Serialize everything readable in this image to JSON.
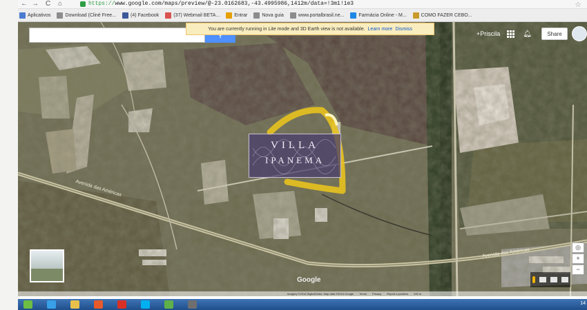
{
  "browser": {
    "nav": {
      "back": "←",
      "forward": "→",
      "reload": "C",
      "home": "⌂"
    },
    "url_scheme": "https://",
    "url_rest": "www.google.com/maps/preview/@-23.0162683,-43.4995986,1412m/data=!3m1!1e3"
  },
  "bookmarks": [
    {
      "label": "Aplicativos",
      "icon": "apps-icon",
      "color": "#4a7bd1"
    },
    {
      "label": "Download (Cliné Free...",
      "icon": "page-icon",
      "color": "#8c8c8c"
    },
    {
      "label": "(4) Facebook",
      "icon": "facebook-icon",
      "color": "#3b5998"
    },
    {
      "label": "(37) Webmail BETA...",
      "icon": "mail-icon",
      "color": "#d9534f"
    },
    {
      "label": "Entrar",
      "icon": "login-icon",
      "color": "#e6a000"
    },
    {
      "label": "Nova guia",
      "icon": "page-icon",
      "color": "#8c8c8c"
    },
    {
      "label": "www.portalbrasil.ne...",
      "icon": "page-icon",
      "color": "#8c8c8c"
    },
    {
      "label": "Farmácia Online - M...",
      "icon": "pharmacy-icon",
      "color": "#1e88e5"
    },
    {
      "label": "COMO FAZER CEBO...",
      "icon": "video-icon",
      "color": "#c89b2b"
    }
  ],
  "map": {
    "banner_text": "You are currently running in Lite mode and 3D Earth view is not available.",
    "banner_learn_more": "Learn more",
    "banner_dismiss": "Dismiss",
    "user_name": "+Priscila",
    "share_label": "Share",
    "road_label": "Avenida das Américas",
    "road_label_right": "Avenida das Américas",
    "logo": "Google",
    "watermark_line1": "VILLA",
    "watermark_line2": "IPANEMA",
    "footer_items": [
      "Imagery ©2014 DigitalGlobe, Map data ©2014 Google",
      "Terms",
      "Privacy",
      "Report a problem",
      "200 m"
    ]
  },
  "taskbar": {
    "icons": [
      {
        "name": "start-orb-icon",
        "color": "#6dbd45"
      },
      {
        "name": "ie-icon",
        "color": "#38a0e8"
      },
      {
        "name": "explorer-icon",
        "color": "#e7c04c"
      },
      {
        "name": "media-icon",
        "color": "#e85a2a"
      },
      {
        "name": "chrome-icon",
        "color": "#d93025"
      },
      {
        "name": "skype-icon",
        "color": "#00aff0"
      },
      {
        "name": "messenger-icon",
        "color": "#5fb14a"
      },
      {
        "name": "app-icon",
        "color": "#6f6f6f"
      }
    ],
    "clock": "14"
  }
}
